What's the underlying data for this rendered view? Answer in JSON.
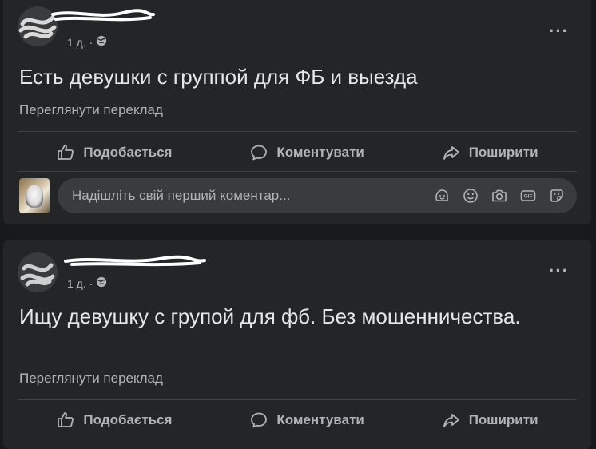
{
  "posts": [
    {
      "time": "1 д. ·",
      "text": "Есть девушки с группой для ФБ и выезда",
      "translate_link": "Переглянути переклад",
      "more_label": "···",
      "actions": {
        "like": "Подобається",
        "comment": "Коментувати",
        "share": "Поширити"
      },
      "comment_placeholder": "Надішліть свій перший коментар..."
    },
    {
      "time": "1 д. ·",
      "text": "Ищу девушку с групой для фб. Без мошенничества.",
      "translate_link": "Переглянути переклад",
      "more_label": "···",
      "actions": {
        "like": "Подобається",
        "comment": "Коментувати",
        "share": "Поширити"
      }
    }
  ],
  "icons": {
    "privacy": "globe-icon",
    "like": "thumbs-up-icon",
    "comment": "speech-bubble-icon",
    "share": "share-arrow-icon",
    "comment_tools": [
      "avatar-sticker-icon",
      "emoji-icon",
      "camera-icon",
      "gif-icon",
      "sticker-icon"
    ]
  },
  "colors": {
    "background": "#18191a",
    "card": "#242526",
    "text_primary": "#e4e6eb",
    "text_secondary": "#b0b3b8",
    "divider": "#3e4042",
    "input_bg": "#3a3b3c"
  }
}
